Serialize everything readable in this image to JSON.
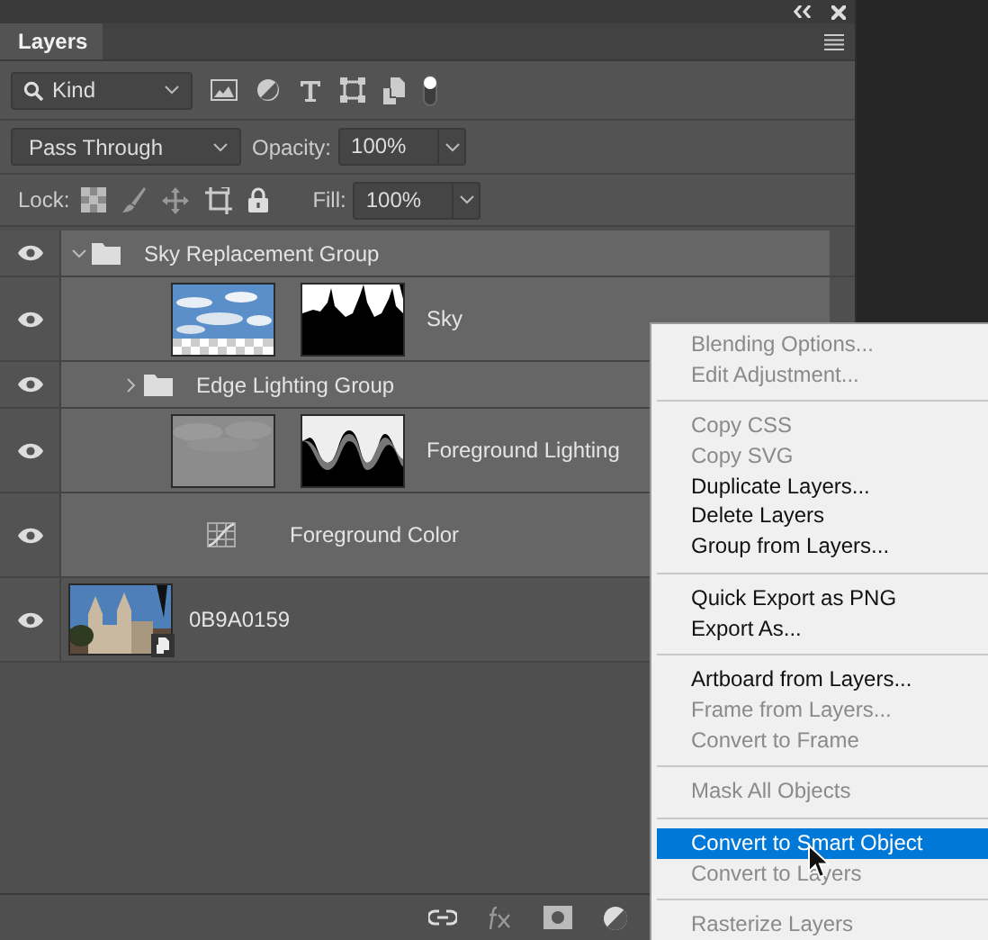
{
  "panel": {
    "tab": "Layers",
    "filter": {
      "value": "Kind"
    },
    "blend_mode": {
      "value": "Pass Through"
    },
    "opacity": {
      "label": "Opacity:",
      "value": "100%"
    },
    "lock": {
      "label": "Lock:"
    },
    "fill": {
      "label": "Fill:",
      "value": "100%"
    }
  },
  "layers": [
    {
      "kind": "group",
      "name": "Sky Replacement Group",
      "selected": true,
      "expanded": true,
      "children": [
        {
          "kind": "masked",
          "name": "Sky",
          "selected": true
        },
        {
          "kind": "group",
          "name": "Edge Lighting Group",
          "selected": true,
          "expanded": false
        },
        {
          "kind": "masked",
          "name": "Foreground Lighting",
          "selected": true
        },
        {
          "kind": "adjustment",
          "name": "Foreground Color",
          "selected": true
        }
      ]
    },
    {
      "kind": "smart",
      "name": "0B9A0159",
      "selected": false
    }
  ],
  "menu": [
    [
      {
        "label": "Blending Options...",
        "disabled": true,
        "selected": false
      },
      {
        "label": "Edit Adjustment...",
        "disabled": true,
        "selected": false
      }
    ],
    [
      {
        "label": "Copy CSS",
        "disabled": true,
        "selected": false
      },
      {
        "label": "Copy SVG",
        "disabled": true,
        "selected": false
      },
      {
        "label": "Duplicate Layers...",
        "disabled": false,
        "selected": false
      },
      {
        "label": "Delete Layers",
        "disabled": false,
        "selected": false
      },
      {
        "label": "Group from Layers...",
        "disabled": false,
        "selected": false
      }
    ],
    [
      {
        "label": "Quick Export as PNG",
        "disabled": false,
        "selected": false
      },
      {
        "label": "Export As...",
        "disabled": false,
        "selected": false
      }
    ],
    [
      {
        "label": "Artboard from Layers...",
        "disabled": false,
        "selected": false
      },
      {
        "label": "Frame from Layers...",
        "disabled": true,
        "selected": false
      },
      {
        "label": "Convert to Frame",
        "disabled": true,
        "selected": false
      }
    ],
    [
      {
        "label": "Mask All Objects",
        "disabled": true,
        "selected": false
      }
    ],
    [
      {
        "label": "Convert to Smart Object",
        "disabled": false,
        "selected": true
      },
      {
        "label": "Convert to Layers",
        "disabled": true,
        "selected": false
      }
    ],
    [
      {
        "label": "Rasterize Layers",
        "disabled": true,
        "selected": false
      }
    ]
  ]
}
